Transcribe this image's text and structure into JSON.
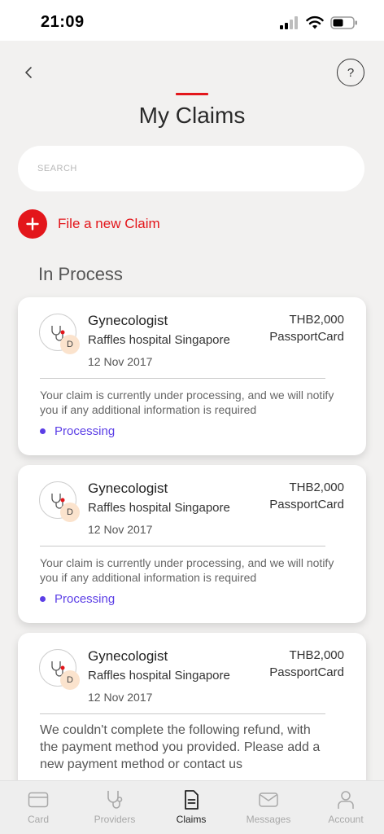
{
  "status_bar": {
    "time": "21:09"
  },
  "header": {
    "title": "My Claims",
    "help_label": "?"
  },
  "colors": {
    "accent": "#e3161b",
    "processing": "#5b3ee6"
  },
  "search": {
    "placeholder": "SEARCH"
  },
  "file_claim": {
    "label": "File a new Claim"
  },
  "section": {
    "title": "In Process"
  },
  "claims": [
    {
      "specialty": "Gynecologist",
      "hospital": "Raffles hospital Singapore",
      "date": "12 Nov 2017",
      "amount": "THB2,000",
      "plan": "PassportCard",
      "badge": "D",
      "message": "Your claim is currently under processing, and we will notify you if any additional information is required",
      "status": "Processing"
    },
    {
      "specialty": "Gynecologist",
      "hospital": "Raffles hospital Singapore",
      "date": "12 Nov 2017",
      "amount": "THB2,000",
      "plan": "PassportCard",
      "badge": "D",
      "message": "Your claim is currently under processing, and we will notify you if any additional information is required",
      "status": "Processing"
    },
    {
      "specialty": "Gynecologist",
      "hospital": "Raffles hospital Singapore",
      "date": "12 Nov 2017",
      "amount": "THB2,000",
      "plan": "PassportCard",
      "badge": "D",
      "message": "We couldn't complete the following refund, with the payment method you provided. Please add a new payment method or contact us"
    }
  ],
  "tabbar": {
    "items": [
      {
        "label": "Card",
        "icon": "card-icon"
      },
      {
        "label": "Providers",
        "icon": "stethoscope-icon"
      },
      {
        "label": "Claims",
        "icon": "document-icon",
        "active": true
      },
      {
        "label": "Messages",
        "icon": "mail-icon"
      },
      {
        "label": "Account",
        "icon": "person-icon"
      }
    ]
  }
}
